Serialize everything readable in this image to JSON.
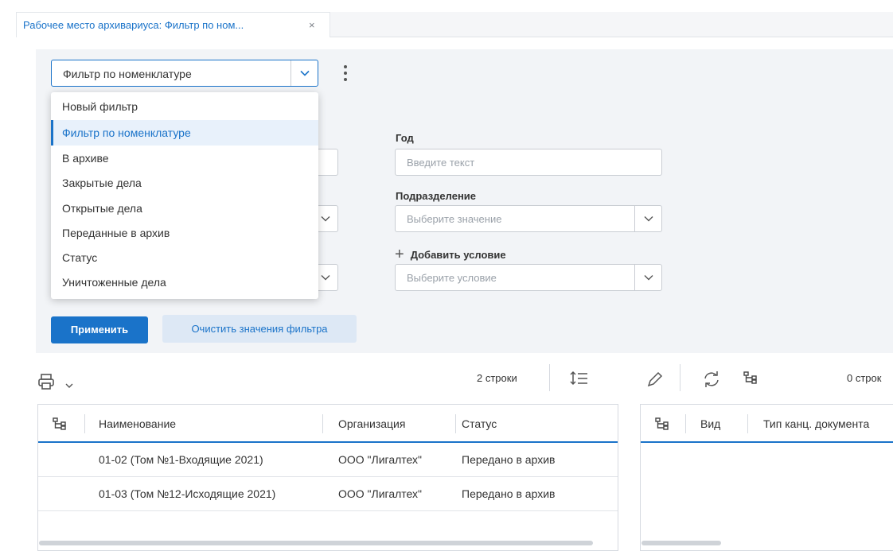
{
  "tab": {
    "title": "Рабочее место архивариуса: Фильтр по ном...",
    "close": "×"
  },
  "filter": {
    "selected": "Фильтр по номенклатуре",
    "options": [
      "Новый фильтр",
      "Фильтр по номенклатуре",
      "В архиве",
      "Закрытые дела",
      "Открытые дела",
      "Переданные в архив",
      "Статус",
      "Уничтоженные дела"
    ],
    "selected_index": 1
  },
  "fields": {
    "year_label": "Год",
    "year_placeholder": "Введите текст",
    "division_label": "Подразделение",
    "division_placeholder": "Выберите значение",
    "add_condition_label": "Добавить условие",
    "condition_placeholder": "Выберите условие"
  },
  "buttons": {
    "apply": "Применить",
    "clear": "Очистить значения фильтра"
  },
  "left_grid": {
    "row_count": "2 строки",
    "columns": [
      "Наименование",
      "Организация",
      "Статус"
    ],
    "rows": [
      [
        "01-02 (Том №1-Входящие 2021)",
        "ООО \"Лигалтех\"",
        "Передано в архив"
      ],
      [
        "01-03 (Том №12-Исходящие 2021)",
        "ООО \"Лигалтех\"",
        "Передано в архив"
      ]
    ]
  },
  "right_grid": {
    "row_count": "0 строк",
    "columns": [
      "Вид",
      "Тип канц. документа"
    ]
  },
  "colors": {
    "accent": "#1a73c9",
    "panel": "#f2f4f7"
  }
}
